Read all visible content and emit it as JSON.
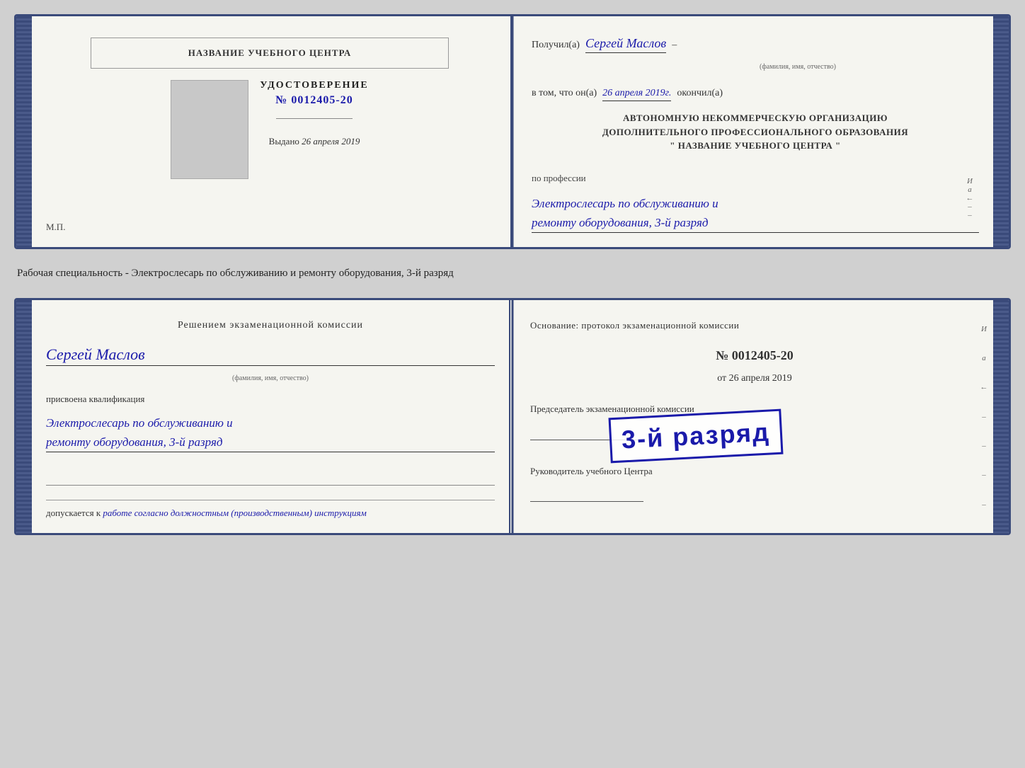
{
  "card1": {
    "left": {
      "school_name": "НАЗВАНИЕ УЧЕБНОГО ЦЕНТРА",
      "cert_title": "УДОСТОВЕРЕНИЕ",
      "cert_number": "№ 0012405-20",
      "issued_label": "Выдано",
      "issued_date": "26 апреля 2019",
      "mp_label": "М.П."
    },
    "right": {
      "received_label": "Получил(а)",
      "recipient_name": "Сергей Маслов",
      "fio_label": "(фамилия, имя, отчество)",
      "dash": "–",
      "that_label": "в том, что он(а)",
      "completion_date": "26 апреля 2019г.",
      "finished_label": "окончил(а)",
      "org_line1": "АВТОНОМНУЮ НЕКОММЕРЧЕСКУЮ ОРГАНИЗАЦИЮ",
      "org_line2": "ДОПОЛНИТЕЛЬНОГО ПРОФЕССИОНАЛЬНОГО ОБРАЗОВАНИЯ",
      "org_line3": "\"   НАЗВАНИЕ УЧЕБНОГО ЦЕНТРА   \"",
      "side_marks": [
        "И",
        "а",
        "←",
        "–",
        "–"
      ],
      "profession_label": "по профессии",
      "profession_value1": "Электрослесарь по обслуживанию и",
      "profession_value2": "ремонту оборудования, 3-й разряд"
    }
  },
  "middle_text": "Рабочая специальность - Электрослесарь по обслуживанию и ремонту оборудования, 3-й разряд",
  "card2": {
    "left": {
      "decision_title": "Решением экзаменационной комиссии",
      "person_name": "Сергей Маслов",
      "fio_label": "(фамилия, имя, отчество)",
      "qualification_label": "присвоена квалификация",
      "qualification_line1": "Электрослесарь по обслуживанию и",
      "qualification_line2": "ремонту оборудования, 3-й разряд",
      "allowed_text": "допускается к",
      "allowed_italic": "работе согласно должностным (производственным) инструкциям"
    },
    "right": {
      "basis_title": "Основание: протокол экзаменационной комиссии",
      "protocol_number": "№  0012405-20",
      "date_prefix": "от",
      "protocol_date": "26 апреля 2019",
      "chairman_label": "Председатель экзаменационной комиссии",
      "head_label": "Руководитель учебного Центра",
      "side_marks": [
        "И",
        "а",
        "←",
        "–",
        "–",
        "–",
        "–"
      ]
    },
    "stamp": {
      "line1": "3-й разряд"
    }
  }
}
